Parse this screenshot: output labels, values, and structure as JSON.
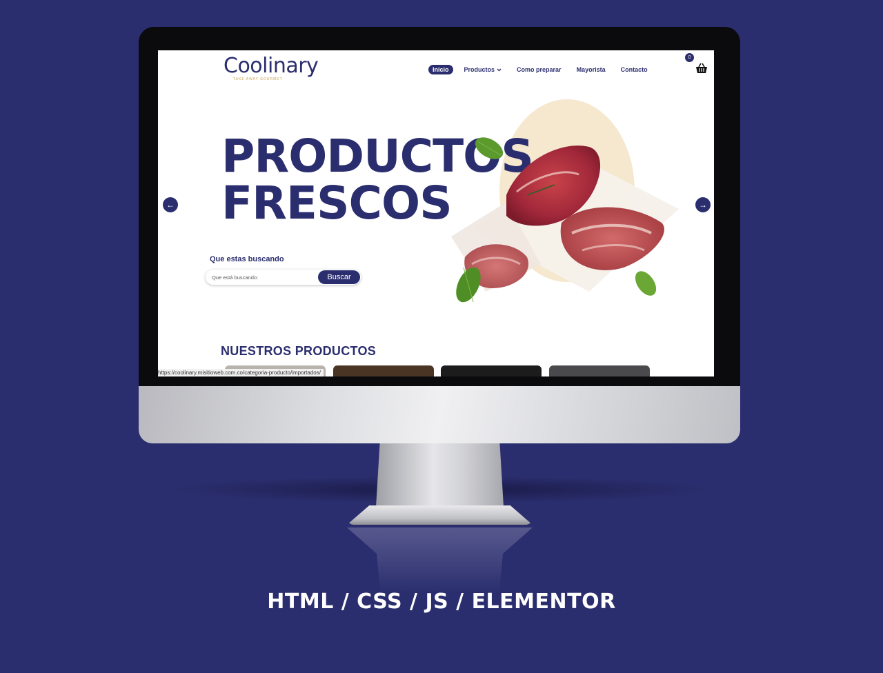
{
  "brand": {
    "name": "Coolinary",
    "tagline": "TAKE AWAY GOURMET"
  },
  "nav": {
    "items": [
      {
        "label": "Inicio",
        "active": true
      },
      {
        "label": "Productos",
        "dropdown": true
      },
      {
        "label": "Como preparar"
      },
      {
        "label": "Mayorista"
      },
      {
        "label": "Contacto"
      }
    ],
    "cart_count": "0"
  },
  "hero": {
    "title_line1": "PRODUCTOS",
    "title_line2": "FRESCOS",
    "prev_arrow": "←",
    "next_arrow": "→"
  },
  "search": {
    "label": "Que estas buscando",
    "placeholder": "Que está buscando:",
    "button": "Buscar"
  },
  "products": {
    "section_title": "NUESTROS PRODUCTOS"
  },
  "status_bar": {
    "url": "https://coolinary.misitioweb.com.co/categoria-producto/importados/"
  },
  "caption": "HTML  / CSS / JS / ELEMENTOR",
  "colors": {
    "brand": "#2b2e6e",
    "background": "#2b2e6e",
    "accent": "#c9a050",
    "hero_circle": "#f5e8cf"
  }
}
